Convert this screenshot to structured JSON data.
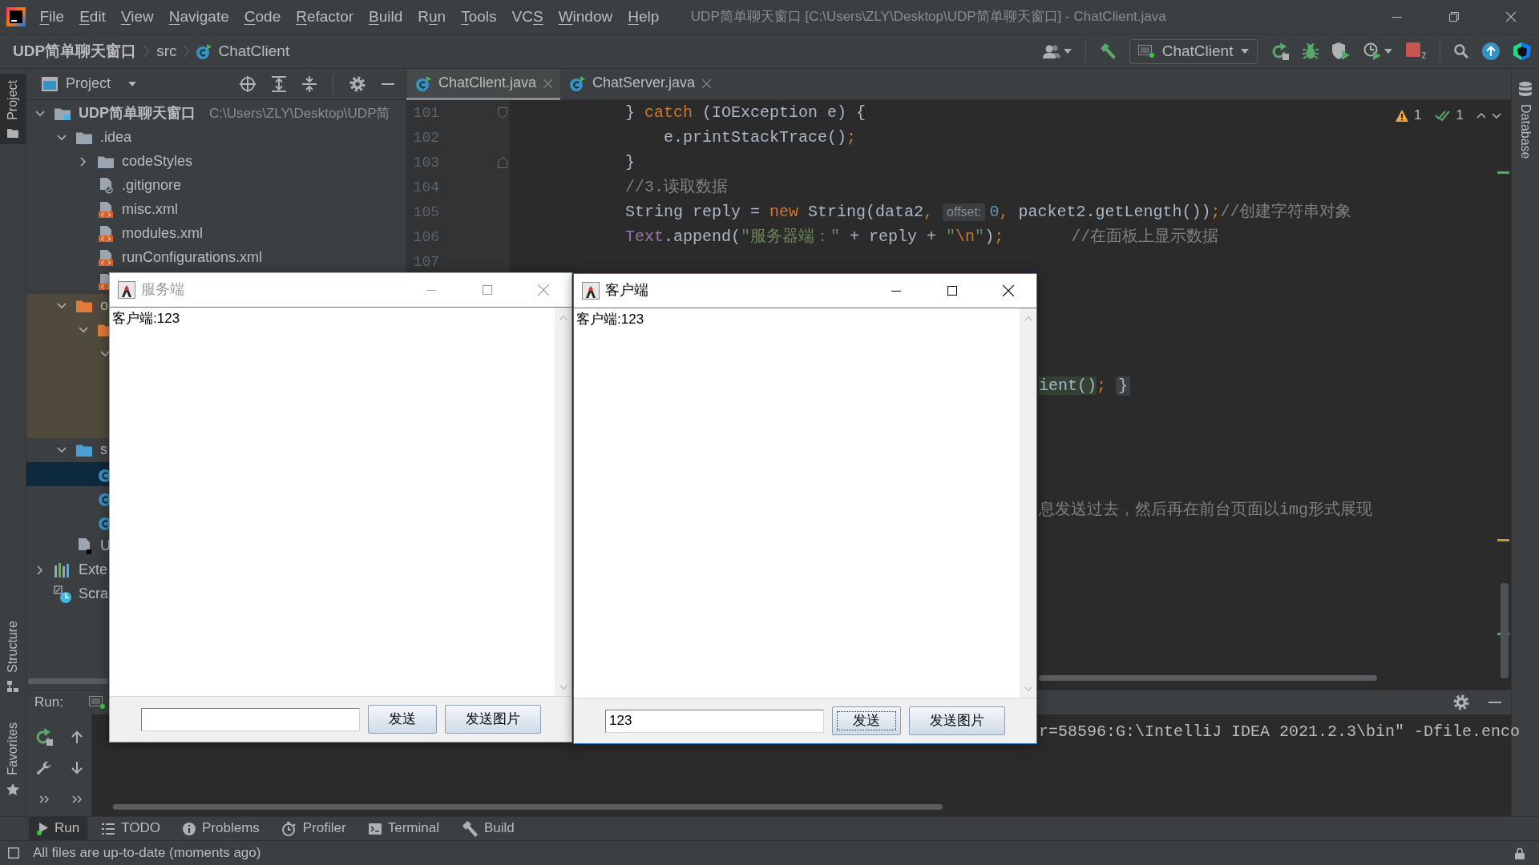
{
  "title_bar": {
    "menus": [
      {
        "mnemonic": "F",
        "after": "ile"
      },
      {
        "mnemonic": "E",
        "after": "dit"
      },
      {
        "mnemonic": "V",
        "after": "iew"
      },
      {
        "mnemonic": "N",
        "after": "avigate"
      },
      {
        "mnemonic": "C",
        "after": "ode"
      },
      {
        "mnemonic": "R",
        "after": "efactor"
      },
      {
        "mnemonic": "B",
        "after": "uild"
      },
      {
        "before": "R",
        "mnemonic": "u",
        "after": "n"
      },
      {
        "mnemonic": "T",
        "after": "ools"
      },
      {
        "before": "VC",
        "mnemonic": "S"
      },
      {
        "mnemonic": "W",
        "after": "indow"
      },
      {
        "mnemonic": "H",
        "after": "elp"
      }
    ],
    "title": "UDP简单聊天窗口 [C:\\Users\\ZLY\\Desktop\\UDP简单聊天窗口] - ChatClient.java"
  },
  "navigation_bar": {
    "breadcrumbs": [
      {
        "label": "UDP简单聊天窗口",
        "kind": "project"
      },
      {
        "label": "src",
        "kind": "folder"
      },
      {
        "label": "ChatClient",
        "kind": "class"
      }
    ],
    "run_configuration": "ChatClient",
    "running_processes": "2"
  },
  "left_stripe": {
    "top": [
      {
        "label": "Project",
        "kind": "project",
        "selected": true
      }
    ],
    "bottom": [
      {
        "label": "Structure",
        "kind": "structure",
        "selected": false
      },
      {
        "label": "Favorites",
        "kind": "favorites",
        "selected": false
      }
    ]
  },
  "project_panel": {
    "title": "Project",
    "tree": [
      {
        "label": "UDP简单聊天窗口",
        "path": "C:\\Users\\ZLY\\Desktop\\UDP简",
        "kind": "module",
        "expanded": true,
        "selected": false,
        "children": [
          {
            "label": ".idea",
            "kind": "folder",
            "expanded": true,
            "selected": false,
            "children": [
              {
                "label": "codeStyles",
                "kind": "folder",
                "expanded": false,
                "selected": false
              },
              {
                "label": ".gitignore",
                "kind": "ignore_file",
                "selected": false
              },
              {
                "label": "misc.xml",
                "kind": "xml_file",
                "selected": false
              },
              {
                "label": "modules.xml",
                "kind": "xml_file",
                "selected": false
              },
              {
                "label": "runConfigurations.xml",
                "kind": "xml_file",
                "selected": false
              },
              {
                "kind": "xml_file",
                "selected": false
              }
            ]
          },
          {
            "label": "o",
            "kind": "excluded_folder",
            "expanded": true,
            "selected": false,
            "children": [
              {
                "kind": "excluded_folder",
                "expanded": true,
                "selected": false,
                "children": [
                  {
                    "expanded": true,
                    "selected": false,
                    "children": [
                      {
                        "selected": false
                      },
                      {
                        "selected": false
                      },
                      {
                        "selected": false
                      }
                    ]
                  }
                ]
              }
            ]
          },
          {
            "label": "s",
            "kind": "source_folder",
            "expanded": true,
            "selected": false,
            "children": [
              {
                "kind": "class",
                "selected": true
              },
              {
                "kind": "class",
                "selected": false
              },
              {
                "kind": "class",
                "selected": false
              }
            ]
          },
          {
            "label": "U",
            "kind": "iml_file",
            "selected": false
          }
        ]
      },
      {
        "label": "Exte",
        "kind": "libraries",
        "expanded": false,
        "selected": false
      },
      {
        "label": "Scra",
        "kind": "scratches",
        "selected": false
      }
    ]
  },
  "editor": {
    "tabs": [
      {
        "label": "ChatClient.java",
        "selected": true
      },
      {
        "label": "ChatServer.java",
        "selected": false
      }
    ],
    "problems": [
      {
        "kind": "warning",
        "count": "1"
      },
      {
        "kind": "weak_warning",
        "count": "1"
      }
    ],
    "lines": [
      {
        "kind": "code",
        "number": "101",
        "tokens": [
          {
            "kind": "plain",
            "text": "} "
          },
          {
            "kind": "keyword",
            "text": "catch"
          },
          {
            "kind": "plain",
            "text": " (IOException e) {"
          }
        ],
        "children": [
          {
            "kind": "code",
            "number": "102",
            "tokens": [
              {
                "kind": "plain",
                "text": "e.printStackTrace()"
              },
              {
                "kind": "punct",
                "text": ";"
              }
            ]
          }
        ]
      },
      {
        "kind": "code",
        "number": "103",
        "fold_end": true,
        "tokens": [
          {
            "kind": "plain",
            "text": "}"
          }
        ]
      },
      {
        "kind": "code",
        "number": "104",
        "tokens": [
          {
            "kind": "comment",
            "text": "//3.读取数据"
          }
        ]
      },
      {
        "kind": "code",
        "number": "105",
        "tokens": [
          {
            "kind": "plain",
            "text": "String reply = "
          },
          {
            "kind": "keyword",
            "text": "new"
          },
          {
            "kind": "plain",
            "text": " String(data2"
          },
          {
            "kind": "punct",
            "text": ", "
          },
          {
            "kind": "hint",
            "text": "offset:"
          },
          {
            "kind": "number",
            "text": "0"
          },
          {
            "kind": "punct",
            "text": ", "
          },
          {
            "kind": "plain",
            "text": "packet2.getLength())"
          },
          {
            "kind": "punct",
            "text": ";"
          },
          {
            "kind": "comment",
            "text": "//创建字符串对象"
          }
        ]
      },
      {
        "kind": "code",
        "number": "106",
        "tokens": [
          {
            "kind": "field",
            "text": "Text"
          },
          {
            "kind": "plain",
            "text": ".append("
          },
          {
            "kind": "string",
            "text": "\"服务器端：\""
          },
          {
            "kind": "plain",
            "text": " + reply + "
          },
          {
            "kind": "string",
            "text": "\""
          },
          {
            "kind": "escape",
            "text": "\\n"
          },
          {
            "kind": "string",
            "text": "\""
          },
          {
            "kind": "plain",
            "text": ")"
          },
          {
            "kind": "punct",
            "text": ";"
          },
          {
            "kind": "comment",
            "text": "       //在面板上显示数据"
          }
        ]
      },
      {
        "kind": "code",
        "number": "107"
      },
      {
        "kind": "covered"
      },
      {
        "kind": "covered"
      },
      {
        "kind": "covered"
      },
      {
        "kind": "covered"
      },
      {
        "kind": "fragment",
        "tokens": [
          {
            "kind": "highlight",
            "text": "ient()"
          },
          {
            "kind": "punct",
            "text": ";"
          },
          {
            "kind": "folded",
            "text": "}"
          }
        ]
      },
      {
        "kind": "covered"
      },
      {
        "kind": "covered"
      },
      {
        "kind": "covered"
      },
      {
        "kind": "covered"
      },
      {
        "kind": "fragment",
        "tokens": [
          {
            "kind": "comment",
            "text": "息发送过去，然后再在前台页面以img形式展现"
          }
        ]
      }
    ]
  },
  "right_stripe": [
    {
      "label": "Database",
      "kind": "database"
    }
  ],
  "run_panel": {
    "title": "Run:",
    "console": [
      "r=58596:G:\\IntelliJ IDEA 2021.2.3\\bin\" -Dfile.enco"
    ]
  },
  "tool_tabs": [
    {
      "label": "Run",
      "kind": "run",
      "selected": true
    },
    {
      "label": "TODO",
      "kind": "todo",
      "selected": false
    },
    {
      "label": "Problems",
      "kind": "problems",
      "selected": false
    },
    {
      "label": "Profiler",
      "kind": "profiler",
      "selected": false
    },
    {
      "label": "Terminal",
      "kind": "terminal",
      "selected": false
    },
    {
      "label": "Build",
      "kind": "build",
      "selected": false
    }
  ],
  "status_bar": {
    "message": "All files are up-to-date (moments ago)"
  },
  "windows": [
    {
      "title": "服务端",
      "active": false,
      "messages": [
        "客户端:123"
      ],
      "buttons": [
        {
          "label": "发送",
          "focused": false
        },
        {
          "label": "发送图片",
          "focused": false
        }
      ]
    },
    {
      "title": "客户端",
      "active": true,
      "messages": [
        "客户端:123"
      ],
      "input_value": "123",
      "buttons": [
        {
          "label": "发送",
          "focused": true
        },
        {
          "label": "发送图片",
          "focused": false
        }
      ]
    }
  ]
}
